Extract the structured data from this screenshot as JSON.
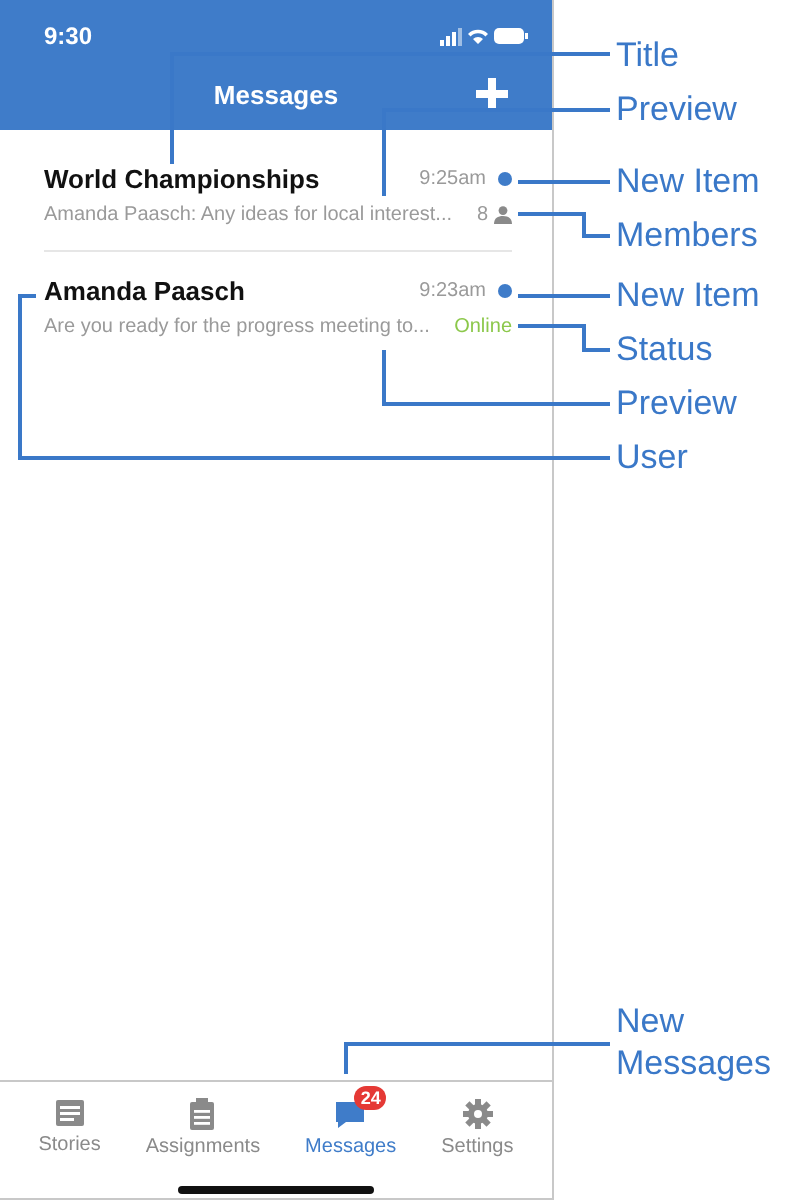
{
  "status_bar": {
    "time": "9:30"
  },
  "header": {
    "title": "Messages"
  },
  "conversations": [
    {
      "title": "World Championships",
      "preview": "Amanda Paasch: Any ideas for local interest...",
      "time": "9:25am",
      "unread": true,
      "kind": "members",
      "meta": "8"
    },
    {
      "title": "Amanda Paasch",
      "preview": "Are you ready for the progress meeting to...",
      "time": "9:23am",
      "unread": true,
      "kind": "status",
      "meta": "Online"
    }
  ],
  "tabs": [
    {
      "label": "Stories",
      "kind": "stories",
      "selected": false
    },
    {
      "label": "Assignments",
      "kind": "assignments",
      "selected": false
    },
    {
      "label": "Messages",
      "kind": "messages",
      "selected": true,
      "badge": "24"
    },
    {
      "label": "Settings",
      "kind": "settings",
      "selected": false
    }
  ],
  "callouts": [
    "Title",
    "Preview",
    "New Item",
    "Members",
    "New Item",
    "Status",
    "Preview",
    "User",
    "New\nMessages"
  ]
}
